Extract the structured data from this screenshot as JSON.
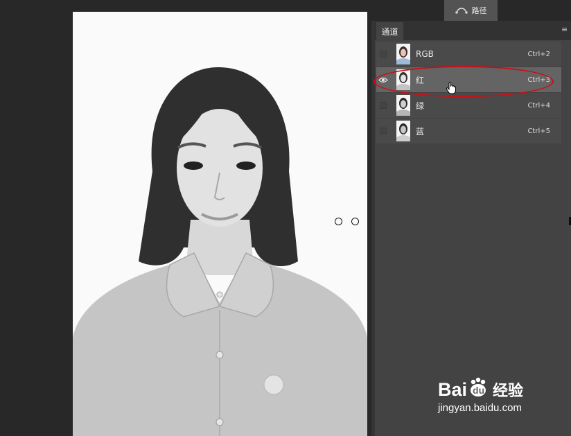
{
  "paths_tab": {
    "label": "路径",
    "icon": "path-icon"
  },
  "channels_panel": {
    "tab_label": "通道",
    "menu_icon": "panel-menu-icon",
    "channels": [
      {
        "name": "RGB",
        "shortcut": "Ctrl+2",
        "visible": false,
        "selected": false,
        "thumb": "color"
      },
      {
        "name": "红",
        "shortcut": "Ctrl+3",
        "visible": true,
        "selected": true,
        "thumb": "gray"
      },
      {
        "name": "绿",
        "shortcut": "Ctrl+4",
        "visible": false,
        "selected": false,
        "thumb": "gray"
      },
      {
        "name": "蓝",
        "shortcut": "Ctrl+5",
        "visible": false,
        "selected": false,
        "thumb": "gray"
      }
    ]
  },
  "annotation": {
    "color": "#c81018",
    "target": "红"
  },
  "watermark": {
    "brand": "Bai",
    "brand_du": "du",
    "cn": "经验",
    "url": "jingyan.baidu.com"
  }
}
